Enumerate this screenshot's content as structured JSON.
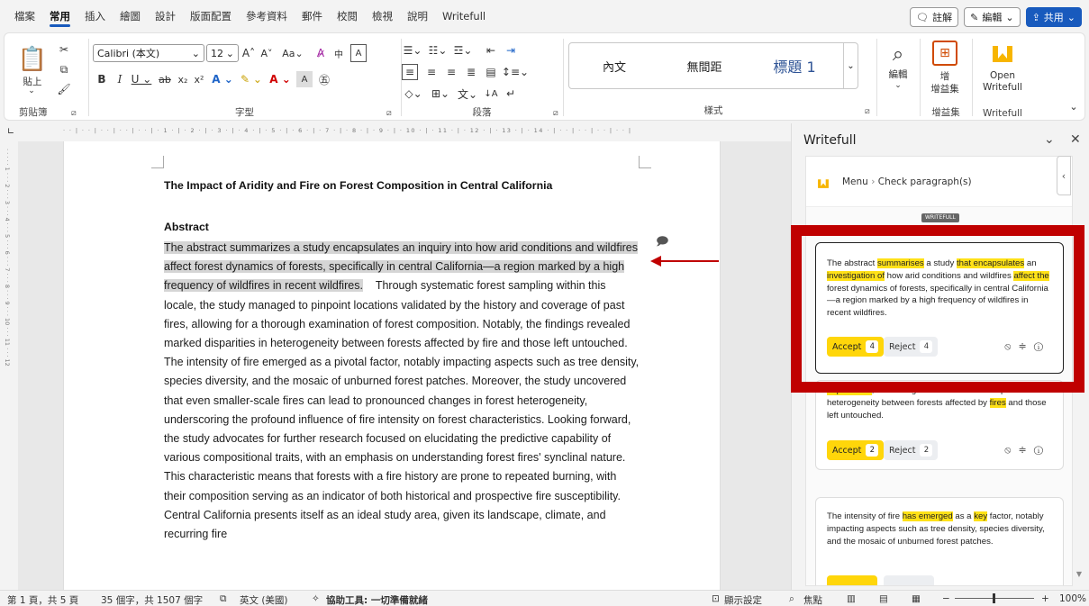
{
  "tabs": [
    "檔案",
    "常用",
    "插入",
    "繪圖",
    "設計",
    "版面配置",
    "參考資料",
    "郵件",
    "校閱",
    "檢視",
    "說明",
    "Writefull"
  ],
  "active_tab": "常用",
  "top_right": {
    "comment": "註解",
    "edit": "編輯",
    "share": "共用"
  },
  "ribbon": {
    "clipboard": {
      "paste": "貼上",
      "label": "剪貼簿"
    },
    "font": {
      "name": "Calibri (本文)",
      "size": "12",
      "label": "字型"
    },
    "paragraph": {
      "label": "段落"
    },
    "styles": {
      "items": [
        "內文",
        "無間距",
        "標題 1"
      ],
      "label": "樣式"
    },
    "editing": {
      "label": "編輯"
    },
    "addins": {
      "label": "增益集",
      "button": "增益集",
      "button_top": "增"
    },
    "writefull": {
      "label": "Writefull",
      "button": "Open Writefull"
    }
  },
  "document": {
    "title": "The Impact of Aridity and Fire on Forest Composition in Central California",
    "abstract_heading": "Abstract",
    "highlighted": "The abstract summarizes a study encapsulates an inquiry into how arid conditions and wildfires affect forest dynamics of forests, specifically in central California—a region marked by a high frequency of wildfires in recent wildfires.",
    "body": "Through systematic forest sampling within this locale, the study managed to pinpoint locations validated by the history and coverage of past fires, allowing for a thorough examination of forest composition. Notably, the findings revealed marked disparities in heterogeneity between forests affected by fire and those left untouched. The intensity of fire emerged as a pivotal factor, notably impacting aspects such as tree density, species diversity, and the mosaic of unburned forest patches. Moreover, the study uncovered that even smaller-scale fires can lead to pronounced changes in forest heterogeneity, underscoring the profound influence of fire intensity on forest characteristics. Looking forward, the study advocates for further research focused on elucidating the predictive capability of various compositional traits, with an emphasis on understanding forest fires' synclinal nature. This characteristic means that forests with a fire history are prone to repeated burning, with their composition serving as an indicator of both historical and prospective fire susceptibility. Central California presents itself as an ideal study area, given its landscape, climate, and recurring fire"
  },
  "panel": {
    "title": "Writefull",
    "menu": "Menu",
    "crumb": "Check paragraph(s)",
    "tag": "WRITEFULL",
    "cards": [
      {
        "parts": [
          [
            "The abstract ",
            false
          ],
          [
            "summarises",
            true
          ],
          [
            " a study ",
            false
          ],
          [
            "that encapsulates",
            true
          ],
          [
            " an ",
            false
          ],
          [
            "investigation of",
            true
          ],
          [
            " how arid conditions and wildfires ",
            false
          ],
          [
            "affect the",
            true
          ],
          [
            " forest dynamics of forests, specifically in central California—a region marked by a high frequency of wildfires in recent wildfires.",
            false
          ]
        ],
        "accept": "Accept",
        "accept_count": "4",
        "reject": "Reject",
        "reject_count": "4"
      },
      {
        "parts": [
          [
            "In particular",
            true
          ],
          [
            ", the findings revealed marked disparities in heterogeneity between forests affected by ",
            false
          ],
          [
            "fires",
            true
          ],
          [
            " and those left untouched.",
            false
          ]
        ],
        "accept": "Accept",
        "accept_count": "2",
        "reject": "Reject",
        "reject_count": "2"
      },
      {
        "parts": [
          [
            "The intensity of fire ",
            false
          ],
          [
            "has emerged",
            true
          ],
          [
            " as a ",
            false
          ],
          [
            "key",
            true
          ],
          [
            " factor, notably impacting aspects such as tree density, species diversity, and the mosaic of unburned forest patches.",
            false
          ]
        ]
      }
    ]
  },
  "status": {
    "page": "第 1 頁，共 5 頁",
    "words": "35 個字，共 1507 個字",
    "lang": "英文 (美國)",
    "access": "協助工具: 一切準備就緒",
    "display": "顯示設定",
    "focus": "焦點",
    "zoom": "100%"
  }
}
